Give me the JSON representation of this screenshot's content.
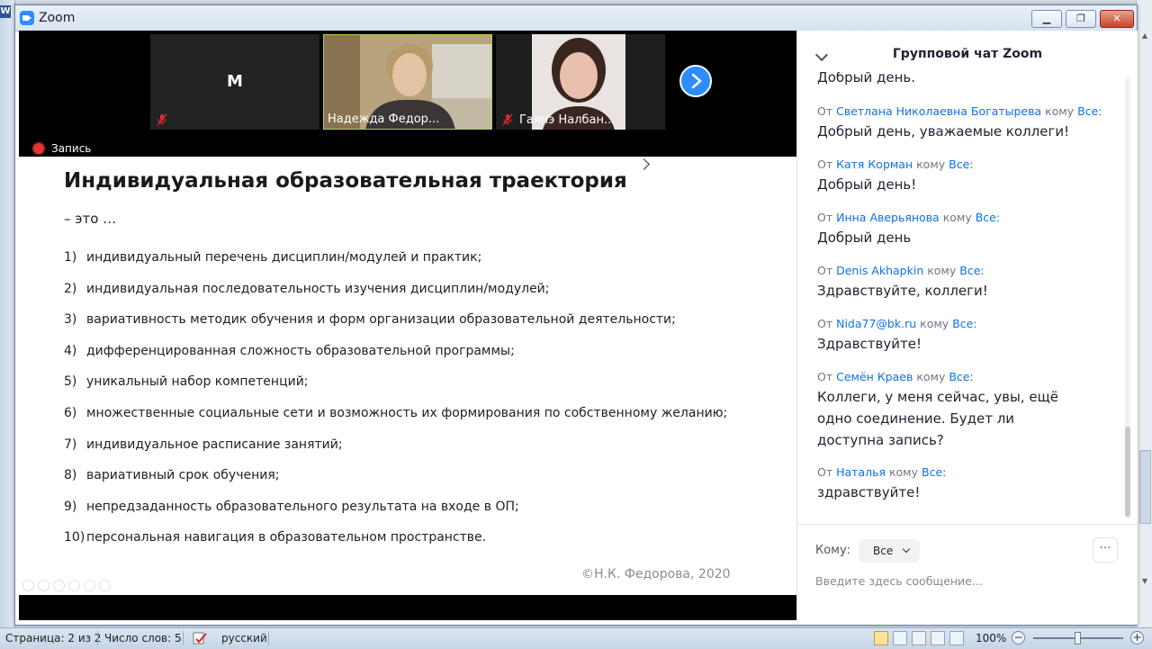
{
  "window": {
    "title": "Zoom",
    "word_icon_letter": "W"
  },
  "video": {
    "tiles": [
      {
        "letter": "M",
        "name": "",
        "muted": true
      },
      {
        "letter": "",
        "name": "Надежда Федор...",
        "muted": false
      },
      {
        "letter": "",
        "name": "Гаянэ Налбан...",
        "muted": true
      }
    ],
    "recording_label": "Запись"
  },
  "slide": {
    "title": "Индивидуальная образовательная траектория",
    "subtitle": "– это …",
    "items": [
      {
        "num": "1)",
        "text": "индивидуальный перечень дисциплин/модулей и практик;"
      },
      {
        "num": "2)",
        "text": "индивидуальная последовательность изучения дисциплин/модулей;"
      },
      {
        "num": "3)",
        "text": "вариативность методик обучения и форм организации образовательной деятельности;"
      },
      {
        "num": "4)",
        "text": "дифференцированная сложность образовательной программы;"
      },
      {
        "num": "5)",
        "text": "уникальный набор компетенций;"
      },
      {
        "num": "6)",
        "text": "множественные социальные сети и возможность их формирования по собственному желанию;"
      },
      {
        "num": "7)",
        "text": "индивидуальное расписание занятий;"
      },
      {
        "num": "8)",
        "text": "вариативный срок обучения;"
      },
      {
        "num": "9)",
        "text": "непредзаданность образовательного результата на входе в ОП;"
      },
      {
        "num": "10)",
        "text": "персональная  навигация в образовательном пространстве."
      }
    ],
    "copyright": "©Н.К. Федорова, 2020"
  },
  "chat": {
    "title": "Групповой чат Zoom",
    "prev_tail": "Добрый день.",
    "messages": [
      {
        "from_label": "От",
        "sender": "Светлана Николаевна Богатырева",
        "to_label": "кому",
        "recipient": "Все:",
        "text": "Добрый день, уважаемые коллеги!"
      },
      {
        "from_label": "От",
        "sender": "Катя Корман",
        "to_label": "кому",
        "recipient": "Все:",
        "text": "Добрый день!"
      },
      {
        "from_label": "От",
        "sender": "Инна Аверьянова",
        "to_label": "кому",
        "recipient": "Все:",
        "text": "Добрый день"
      },
      {
        "from_label": "От",
        "sender": "Denis Akhapkin",
        "to_label": "кому",
        "recipient": "Все:",
        "text": "Здравствуйте, коллеги!"
      },
      {
        "from_label": "От",
        "sender": "Nida77@bk.ru",
        "to_label": "кому",
        "recipient": "Все:",
        "text": "Здравствуйте!"
      },
      {
        "from_label": "От",
        "sender": "Семён Краев",
        "to_label": "кому",
        "recipient": "Все:",
        "text": "Коллеги, у меня сейчас, увы, ещё одно соединение. Будет ли доступна запись?"
      },
      {
        "from_label": "От",
        "sender": "Наталья",
        "to_label": "кому",
        "recipient": "Все:",
        "text": "здравствуйте!"
      }
    ],
    "to_label": "Кому:",
    "to_value": "Все",
    "more_label": "···",
    "input_placeholder": "Введите здесь сообщение..."
  },
  "statusbar": {
    "page": "Страница: 2 из 2",
    "words": "Число слов: 5",
    "language": "русский",
    "zoom": "100%",
    "zoom_minus": "−",
    "zoom_plus": "+"
  },
  "colors": {
    "zoom_blue": "#2d8cff",
    "chat_link": "#0e71eb",
    "recording_red": "#e8332f"
  }
}
